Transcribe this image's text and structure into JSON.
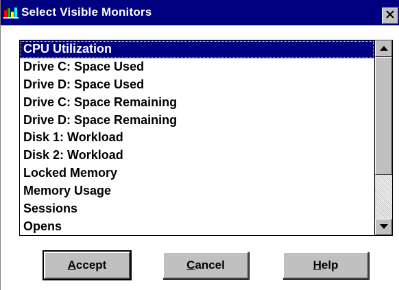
{
  "window": {
    "title": "Select Visible Monitors",
    "title_bar_color": "#000080"
  },
  "icons": {
    "app": "app-monitor-icon",
    "close": "close-icon",
    "scroll_up": "arrow-up-icon",
    "scroll_down": "arrow-down-icon"
  },
  "list": {
    "selected_index": 0,
    "items": [
      "CPU Utilization",
      "Drive C: Space Used",
      "Drive D: Space Used",
      "Drive C: Space Remaining",
      "Drive D: Space Remaining",
      "Disk 1: Workload",
      "Disk 2: Workload",
      "Locked Memory",
      "Memory Usage",
      "Sessions",
      "Opens"
    ]
  },
  "buttons": {
    "accept": {
      "mnemonic": "A",
      "rest": "ccept"
    },
    "cancel": {
      "mnemonic": "C",
      "rest": "ancel"
    },
    "help": {
      "mnemonic": "H",
      "rest": "elp"
    }
  },
  "colors": {
    "selection_bg": "#000080",
    "face": "#c0c0c0"
  }
}
